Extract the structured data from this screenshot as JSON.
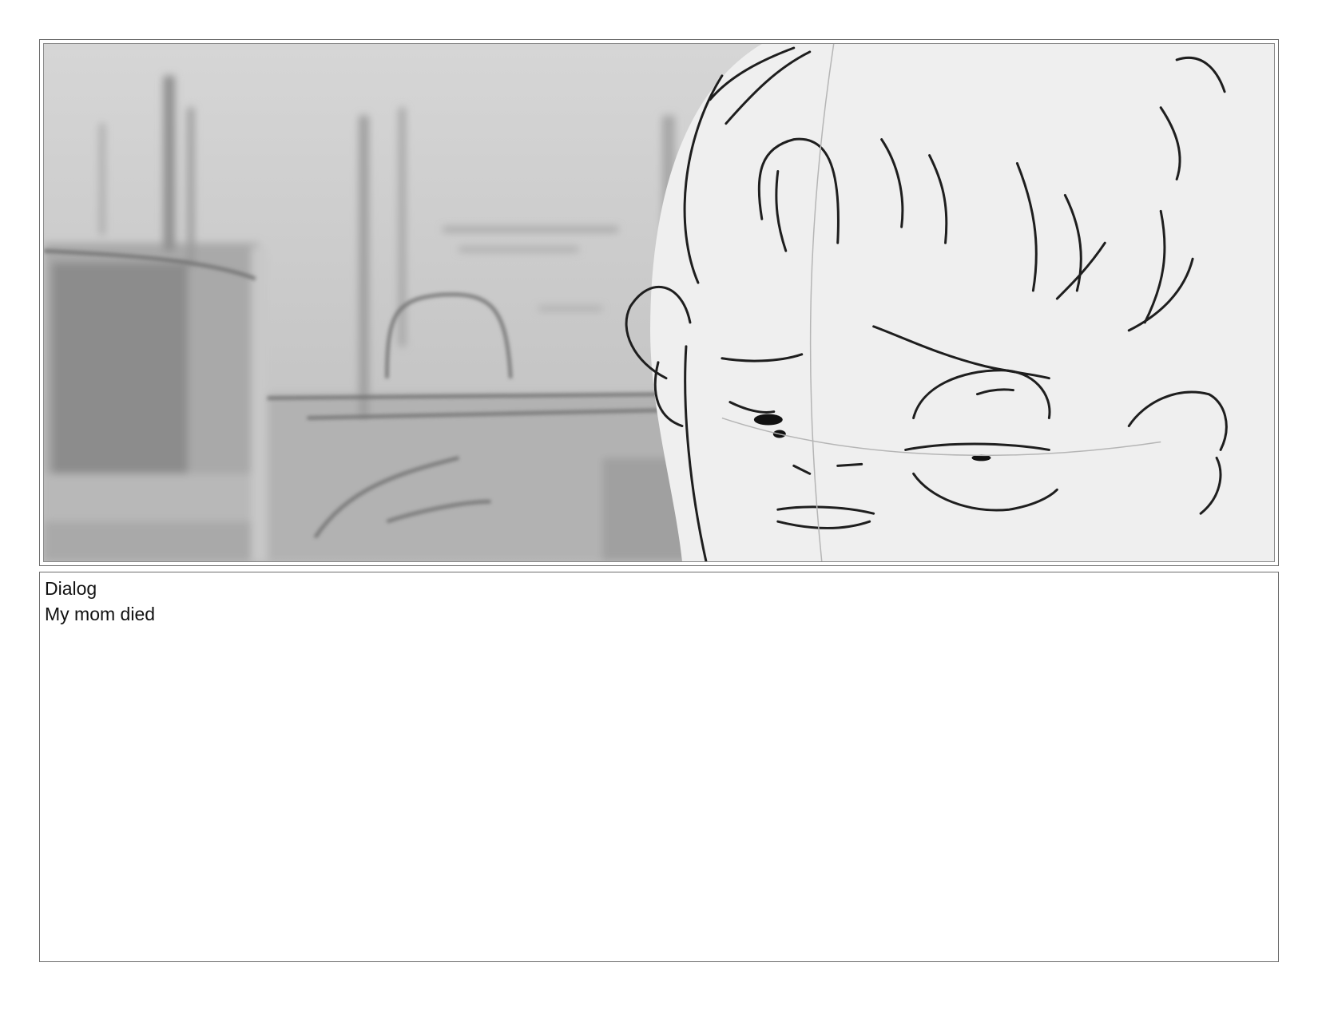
{
  "panel": {
    "image_description_icon": "storyboard-sketch-icon"
  },
  "dialog": {
    "label": "Dialog",
    "text": "My mom died"
  },
  "colors": {
    "border": "#6b6b6b",
    "sketch_background": "#cfcfcf",
    "line": "#1a1a1a"
  }
}
